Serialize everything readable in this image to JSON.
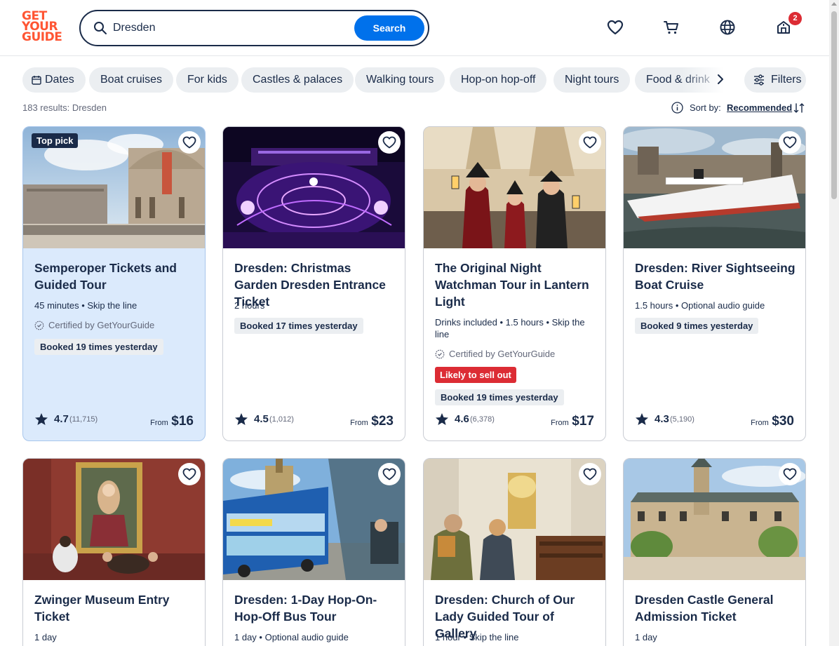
{
  "header": {
    "logo_lines": [
      "GET",
      "YOUR",
      "GUIDE"
    ],
    "search_value": "Dresden",
    "search_button": "Search",
    "cart_badge": "2"
  },
  "chips": [
    "Dates",
    "Boat cruises",
    "For kids",
    "Castles & palaces",
    "Walking tours",
    "Hop-on hop-off",
    "Night tours",
    "Food & drink"
  ],
  "filters_label": "Filters",
  "results_text": "183 results: Dresden",
  "sort": {
    "label": "Sort by:",
    "value": "Recommended"
  },
  "colors": {
    "brand": "#ff5533",
    "accent": "#0071eb",
    "text": "#1a2b49",
    "badge_red": "#dc2c34",
    "top_pick_bg": "#dbeafc"
  },
  "cards": [
    {
      "badge": "Top pick",
      "title": "Semperoper Tickets and Guided Tour",
      "meta": "45 minutes • Skip the line",
      "certified": "Certified by GetYourGuide",
      "booked": "Booked 19 times yesterday",
      "rating": "4.7",
      "reviews": "(11,715)",
      "from": "From",
      "price": "$16"
    },
    {
      "title": "Dresden: Christmas Garden Dresden Entrance Ticket",
      "meta": "2 hours",
      "booked": "Booked 17 times yesterday",
      "rating": "4.5",
      "reviews": "(1,012)",
      "from": "From",
      "price": "$23"
    },
    {
      "title": "The Original Night Watchman Tour in Lantern Light",
      "meta": "Drinks included • 1.5 hours • Skip the line",
      "certified": "Certified by GetYourGuide",
      "likely": "Likely to sell out",
      "booked": "Booked 19 times yesterday",
      "rating": "4.6",
      "reviews": "(6,378)",
      "from": "From",
      "price": "$17"
    },
    {
      "title": "Dresden: River Sightseeing Boat Cruise",
      "meta": "1.5 hours • Optional audio guide",
      "booked": "Booked 9 times yesterday",
      "rating": "4.3",
      "reviews": "(5,190)",
      "from": "From",
      "price": "$30"
    },
    {
      "title": "Zwinger Museum Entry Ticket",
      "meta": "1 day"
    },
    {
      "title": "Dresden: 1-Day Hop-On-Hop-Off Bus Tour",
      "meta": "1 day • Optional audio guide"
    },
    {
      "title": "Dresden: Church of Our Lady Guided Tour of Gallery",
      "meta": "1 hour • Skip the line"
    },
    {
      "title": "Dresden Castle General Admission Ticket",
      "meta": "1 day"
    }
  ]
}
